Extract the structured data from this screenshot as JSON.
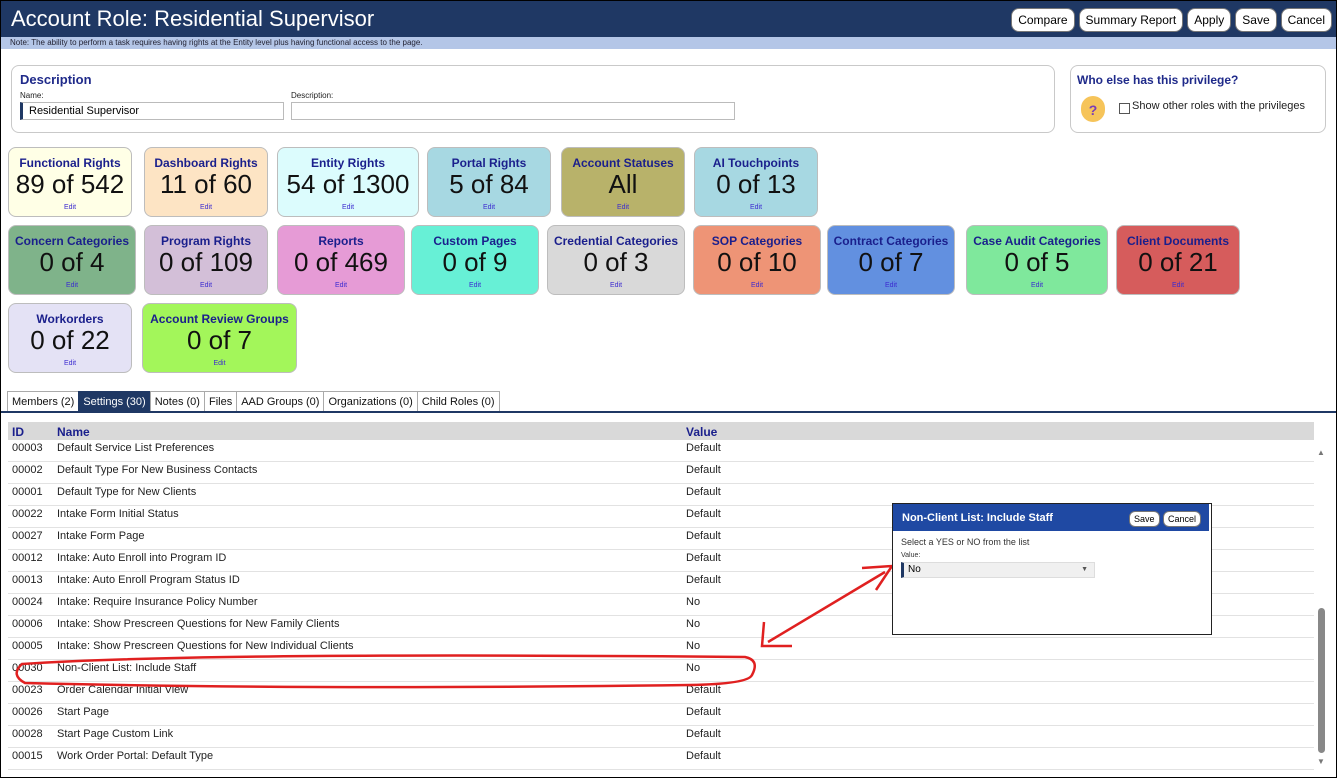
{
  "header": {
    "title": "Account Role: Residential Supervisor",
    "buttons": [
      "Compare",
      "Summary Report",
      "Apply",
      "Save",
      "Cancel"
    ]
  },
  "note": "Note: The ability to perform a task requires having rights at the Entity level plus having functional access to the page.",
  "description": {
    "heading": "Description",
    "name_label": "Name:",
    "name_value": "Residential Supervisor",
    "desc_label": "Description:",
    "desc_value": ""
  },
  "who": {
    "heading": "Who else has this privilege?",
    "checkbox_label": "Show other roles with the privileges"
  },
  "tiles": [
    {
      "title": "Functional Rights",
      "value": "89 of 542",
      "edit": "Edit",
      "color": "#ffffe6"
    },
    {
      "title": "Dashboard Rights",
      "value": "11 of 60",
      "edit": "Edit",
      "color": "#fde4c4"
    },
    {
      "title": "Entity Rights",
      "value": "54 of 1300",
      "edit": "Edit",
      "color": "#dcfcfd"
    },
    {
      "title": "Portal Rights",
      "value": "5 of 84",
      "edit": "Edit",
      "color": "#a7d8e2"
    },
    {
      "title": "Account Statuses",
      "value": "All",
      "edit": "Edit",
      "color": "#b8b26a"
    },
    {
      "title": "AI Touchpoints",
      "value": "0 of 13",
      "edit": "Edit",
      "color": "#a7d8e2"
    },
    {
      "title": "Concern Categories",
      "value": "0 of 4",
      "edit": "Edit",
      "color": "#7fb38a"
    },
    {
      "title": "Program Rights",
      "value": "0 of 109",
      "edit": "Edit",
      "color": "#d3bfd8"
    },
    {
      "title": "Reports",
      "value": "0 of 469",
      "edit": "Edit",
      "color": "#e69bd6"
    },
    {
      "title": "Custom Pages",
      "value": "0 of 9",
      "edit": "Edit",
      "color": "#67f0d6"
    },
    {
      "title": "Credential Categories",
      "value": "0 of 3",
      "edit": "Edit",
      "color": "#d9d9d9"
    },
    {
      "title": "SOP Categories",
      "value": "0 of 10",
      "edit": "Edit",
      "color": "#ee9476"
    },
    {
      "title": "Contract Categories",
      "value": "0 of 7",
      "edit": "Edit",
      "color": "#6290e0"
    },
    {
      "title": "Case Audit Categories",
      "value": "0 of 5",
      "edit": "Edit",
      "color": "#7fe89c"
    },
    {
      "title": "Client Documents",
      "value": "0 of 21",
      "edit": "Edit",
      "color": "#d65c5c"
    },
    {
      "title": "Workorders",
      "value": "0 of 22",
      "edit": "Edit",
      "color": "#e4e2f5"
    },
    {
      "title": "Account Review Groups",
      "value": "0 of 7",
      "edit": "Edit",
      "color": "#a3f65a"
    }
  ],
  "tabs": [
    "Members (2)",
    "Settings (30)",
    "Notes (0)",
    "Files",
    "AAD Groups (0)",
    "Organizations (0)",
    "Child Roles (0)"
  ],
  "active_tab": "Settings (30)",
  "table": {
    "headers": {
      "id": "ID",
      "name": "Name",
      "value": "Value"
    },
    "rows": [
      {
        "id": "00003",
        "name": "Default Service List Preferences",
        "value": "Default"
      },
      {
        "id": "00002",
        "name": "Default Type For New Business Contacts",
        "value": "Default"
      },
      {
        "id": "00001",
        "name": "Default Type for New Clients",
        "value": "Default"
      },
      {
        "id": "00022",
        "name": "Intake Form Initial Status",
        "value": "Default"
      },
      {
        "id": "00027",
        "name": "Intake Form Page",
        "value": "Default"
      },
      {
        "id": "00012",
        "name": "Intake: Auto Enroll into Program ID",
        "value": "Default"
      },
      {
        "id": "00013",
        "name": "Intake: Auto Enroll Program Status ID",
        "value": "Default"
      },
      {
        "id": "00024",
        "name": "Intake: Require Insurance Policy Number",
        "value": "No"
      },
      {
        "id": "00006",
        "name": "Intake: Show Prescreen Questions for New Family Clients",
        "value": "No"
      },
      {
        "id": "00005",
        "name": "Intake: Show Prescreen Questions for New Individual Clients",
        "value": "No"
      },
      {
        "id": "00030",
        "name": "Non-Client List: Include Staff",
        "value": "No"
      },
      {
        "id": "00023",
        "name": "Order Calendar Initial View",
        "value": "Default"
      },
      {
        "id": "00026",
        "name": "Start Page",
        "value": "Default"
      },
      {
        "id": "00028",
        "name": "Start Page Custom Link",
        "value": "Default"
      },
      {
        "id": "00015",
        "name": "Work Order Portal: Default Type",
        "value": "Default"
      }
    ]
  },
  "popup": {
    "title": "Non-Client List: Include Staff",
    "save": "Save",
    "cancel": "Cancel",
    "description": "Select a YES or NO from the list",
    "value_label": "Value:",
    "value": "No"
  },
  "annotation_color": "#e02020"
}
